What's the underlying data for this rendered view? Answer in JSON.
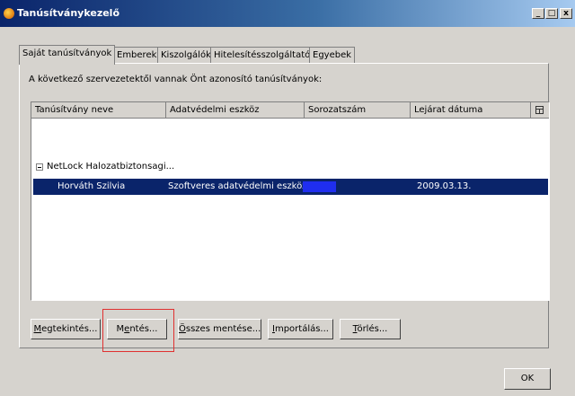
{
  "window": {
    "title": "Tanúsítványkezelő",
    "icon": "firefox-logo-icon",
    "controls": {
      "minimize": "_",
      "maximize": "□",
      "close": "x"
    }
  },
  "tabs": [
    {
      "label": "Saját tanúsítványok",
      "active": true
    },
    {
      "label": "Emberek",
      "active": false
    },
    {
      "label": "Kiszolgálók",
      "active": false
    },
    {
      "label": "Hitelesítésszolgáltatók",
      "active": false
    },
    {
      "label": "Egyebek",
      "active": false
    }
  ],
  "info_text": "A következő szervezetektől vannak Önt azonosító tanúsítványok:",
  "table": {
    "columns": [
      "Tanúsítvány neve",
      "Adatvédelmi eszköz",
      "Sorozatszám",
      "Lejárat dátuma"
    ],
    "column_picker_icon": "column-picker-icon",
    "groups": [
      {
        "name": "NetLock Halozatbiztonsagi...",
        "expanded": true,
        "rows": [
          {
            "name": "Horváth Szilvia",
            "device": "Szoftveres adatvédelmi eszköz",
            "serial": "",
            "expiry": "2009.03.13.",
            "selected": true
          }
        ]
      }
    ]
  },
  "buttons": [
    {
      "label": "Megtekintés...",
      "mnemonic": "M"
    },
    {
      "label": "Mentés...",
      "mnemonic": "e"
    },
    {
      "label": "Összes mentése...",
      "mnemonic": "Ö"
    },
    {
      "label": "Importálás...",
      "mnemonic": "I"
    },
    {
      "label": "Törlés...",
      "mnemonic": "T"
    }
  ],
  "ok_button": "OK",
  "colors": {
    "selection": "#0a246a",
    "highlight_box": "#e03030",
    "face": "#d6d3ce"
  }
}
